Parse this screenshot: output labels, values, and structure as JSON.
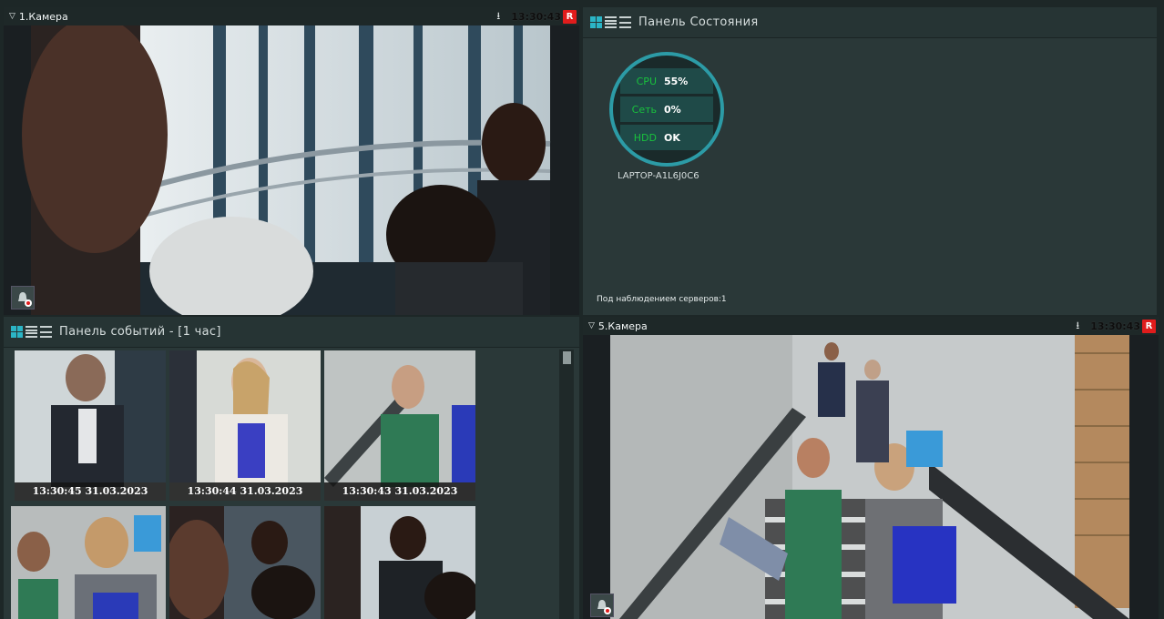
{
  "camera1": {
    "title": "1.Камера",
    "time": "13:30:43",
    "rec_badge": "R"
  },
  "camera5": {
    "title": "5.Камера",
    "time": "13:30:43",
    "rec_badge": "R"
  },
  "status_panel": {
    "title": "Панель Состояния",
    "rows": [
      {
        "label": "CPU",
        "value": "55%"
      },
      {
        "label": "Сеть",
        "value": "0%"
      },
      {
        "label": "HDD",
        "value": "OK"
      }
    ],
    "host": "LAPTOP-A1L6J0C6",
    "footer": "Под наблюдением серверов:1"
  },
  "events_panel": {
    "title": "Панель событий - [1 час]",
    "thumbs": [
      {
        "stamp": "13:30:45 31.03.2023"
      },
      {
        "stamp": "13:30:44 31.03.2023"
      },
      {
        "stamp": "13:30:43 31.03.2023"
      }
    ]
  },
  "icons": {
    "filter": "triangle-down-icon",
    "download": "download-arrow-icon",
    "alarm": "alarm-bell-icon",
    "tiles": "tiles-view-icon",
    "list": "list-view-icon",
    "details": "details-view-icon"
  },
  "colors": {
    "accent": "#2bb5c6",
    "rec": "#e01c1c",
    "ok_green": "#19c23d"
  }
}
